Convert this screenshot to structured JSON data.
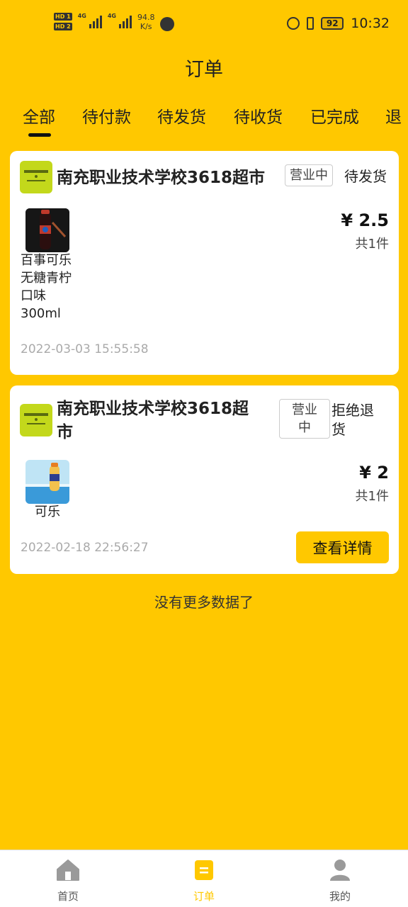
{
  "status_bar": {
    "hd1": "HD 1",
    "hd2": "HD 2",
    "net1": "4G",
    "net2": "4G",
    "speed_value": "94.8",
    "speed_unit": "K/s",
    "battery": "92",
    "time": "10:32"
  },
  "header": {
    "title": "订单"
  },
  "tabs": [
    {
      "label": "全部",
      "active": true
    },
    {
      "label": "待付款"
    },
    {
      "label": "待发货"
    },
    {
      "label": "待收货"
    },
    {
      "label": "已完成"
    },
    {
      "label": "退"
    }
  ],
  "orders": [
    {
      "store_name": "南充职业技术学校3618超市",
      "store_status": "营业中",
      "order_status": "待发货",
      "product_name_lines": [
        "百事可乐",
        "无糖青柠",
        "口味",
        "300ml"
      ],
      "price": "¥ 2.5",
      "quantity": "共1件",
      "time": "2022-03-03 15:55:58"
    },
    {
      "store_name_lines": [
        "南充职业技术学校3618超",
        "市"
      ],
      "store_status_lines": [
        "营业",
        "中"
      ],
      "order_status_lines": [
        "拒绝退",
        "货"
      ],
      "product_name": "可乐",
      "price": "¥ 2",
      "quantity": "共1件",
      "time": "2022-02-18 22:56:27",
      "detail_button": "查看详情"
    }
  ],
  "footer_text": "没有更多数据了",
  "bottom_nav": [
    {
      "label": "首页",
      "icon": "home-icon"
    },
    {
      "label": "订单",
      "icon": "order-icon",
      "active": true
    },
    {
      "label": "我的",
      "icon": "user-icon"
    }
  ],
  "colors": {
    "accent": "#FFC800",
    "card": "#FFFFFF",
    "muted": "#AAAAAA"
  }
}
